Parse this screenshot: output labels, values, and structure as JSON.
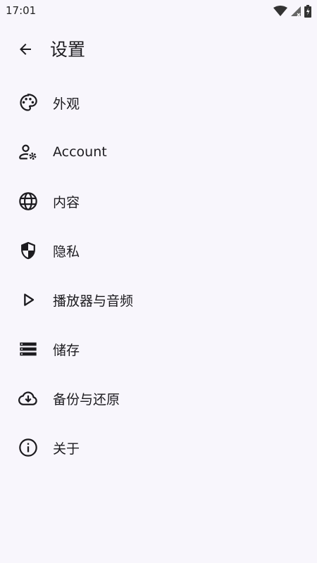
{
  "status_bar": {
    "time": "17:01"
  },
  "header": {
    "title": "设置"
  },
  "settings": {
    "items": [
      {
        "label": "外观",
        "icon": "palette-icon"
      },
      {
        "label": "Account",
        "icon": "account-settings-icon"
      },
      {
        "label": "内容",
        "icon": "globe-icon"
      },
      {
        "label": "隐私",
        "icon": "shield-icon"
      },
      {
        "label": "播放器与音频",
        "icon": "play-icon"
      },
      {
        "label": "储存",
        "icon": "storage-icon"
      },
      {
        "label": "备份与还原",
        "icon": "cloud-download-icon"
      },
      {
        "label": "关于",
        "icon": "info-icon"
      }
    ]
  }
}
